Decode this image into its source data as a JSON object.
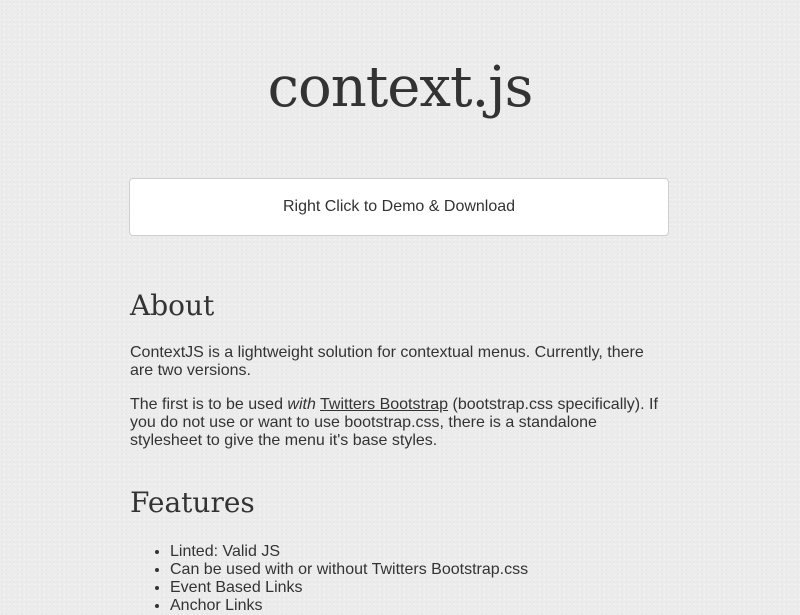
{
  "header": {
    "title": "context.js"
  },
  "demo": {
    "label": "Right Click to Demo & Download"
  },
  "about": {
    "heading": "About",
    "paragraph1": "ContextJS is a lightweight solution for contextual menus. Currently, there are two versions.",
    "paragraph2": {
      "before": "The first is to be used ",
      "emphasis": "with",
      "space": " ",
      "link": "Twitters Bootstrap",
      "after": " (bootstrap.css specifically). If you do not use or want to use bootstrap.css, there is a standalone stylesheet to give the menu it's base styles."
    }
  },
  "features": {
    "heading": "Features",
    "items": [
      "Linted: Valid JS",
      "Can be used with or without Twitters Bootstrap.css",
      "Event Based Links",
      "Anchor Links"
    ]
  },
  "colors": {
    "background": "#ececec",
    "text": "#333333",
    "panel": "#ffffff",
    "panel_border": "#cfcfcf"
  }
}
